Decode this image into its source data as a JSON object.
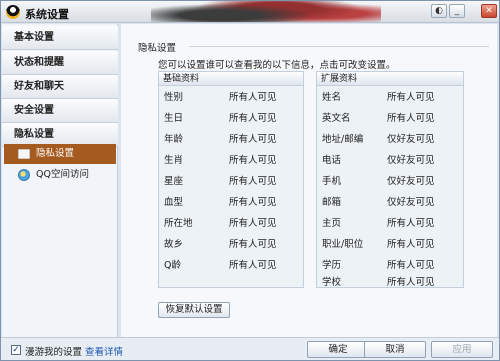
{
  "window": {
    "title": "系统设置",
    "controls": [
      "◐",
      "_",
      "▢",
      "✕"
    ]
  },
  "sidebar": {
    "categories": [
      {
        "label": "基本设置"
      },
      {
        "label": "状态和提醒"
      },
      {
        "label": "好友和聊天"
      },
      {
        "label": "安全设置"
      },
      {
        "label": "隐私设置"
      }
    ],
    "subitems": [
      {
        "label": "隐私设置",
        "icon": "folder-icon",
        "active": true
      },
      {
        "label": "QQ空间访问",
        "icon": "qzone-icon",
        "active": false
      }
    ]
  },
  "panel": {
    "section_title": "隐私设置",
    "description": "您可以设置谁可以查看我的以下信息，点击可改变设置。",
    "basic": {
      "title": "基础资料",
      "rows": [
        {
          "field": "性别",
          "value": "所有人可见"
        },
        {
          "field": "生日",
          "value": "所有人可见"
        },
        {
          "field": "年龄",
          "value": "所有人可见"
        },
        {
          "field": "生肖",
          "value": "所有人可见"
        },
        {
          "field": "星座",
          "value": "所有人可见"
        },
        {
          "field": "血型",
          "value": "所有人可见"
        },
        {
          "field": "所在地",
          "value": "所有人可见"
        },
        {
          "field": "故乡",
          "value": "所有人可见"
        },
        {
          "field": "Q龄",
          "value": "所有人可见"
        }
      ]
    },
    "extended": {
      "title": "扩展资料",
      "rows": [
        {
          "field": "姓名",
          "value": "所有人可见"
        },
        {
          "field": "英文名",
          "value": "所有人可见"
        },
        {
          "field": "地址/邮编",
          "value": "仅好友可见"
        },
        {
          "field": "电话",
          "value": "仅好友可见"
        },
        {
          "field": "手机",
          "value": "仅好友可见"
        },
        {
          "field": "邮箱",
          "value": "仅好友可见"
        },
        {
          "field": "主页",
          "value": "所有人可见"
        },
        {
          "field": "职业/职位",
          "value": "所有人可见"
        },
        {
          "field": "学历",
          "value": "所有人可见"
        },
        {
          "field": "学校",
          "value": "所有人可见"
        }
      ]
    },
    "restore_label": "恢复默认设置"
  },
  "footer": {
    "checkbox_label": "漫游我的设置",
    "checkbox_checked": true,
    "checkmark": "✓",
    "details_link": "查看详情",
    "ok_label": "确定",
    "cancel_label": "取消",
    "apply_label": "应用"
  }
}
